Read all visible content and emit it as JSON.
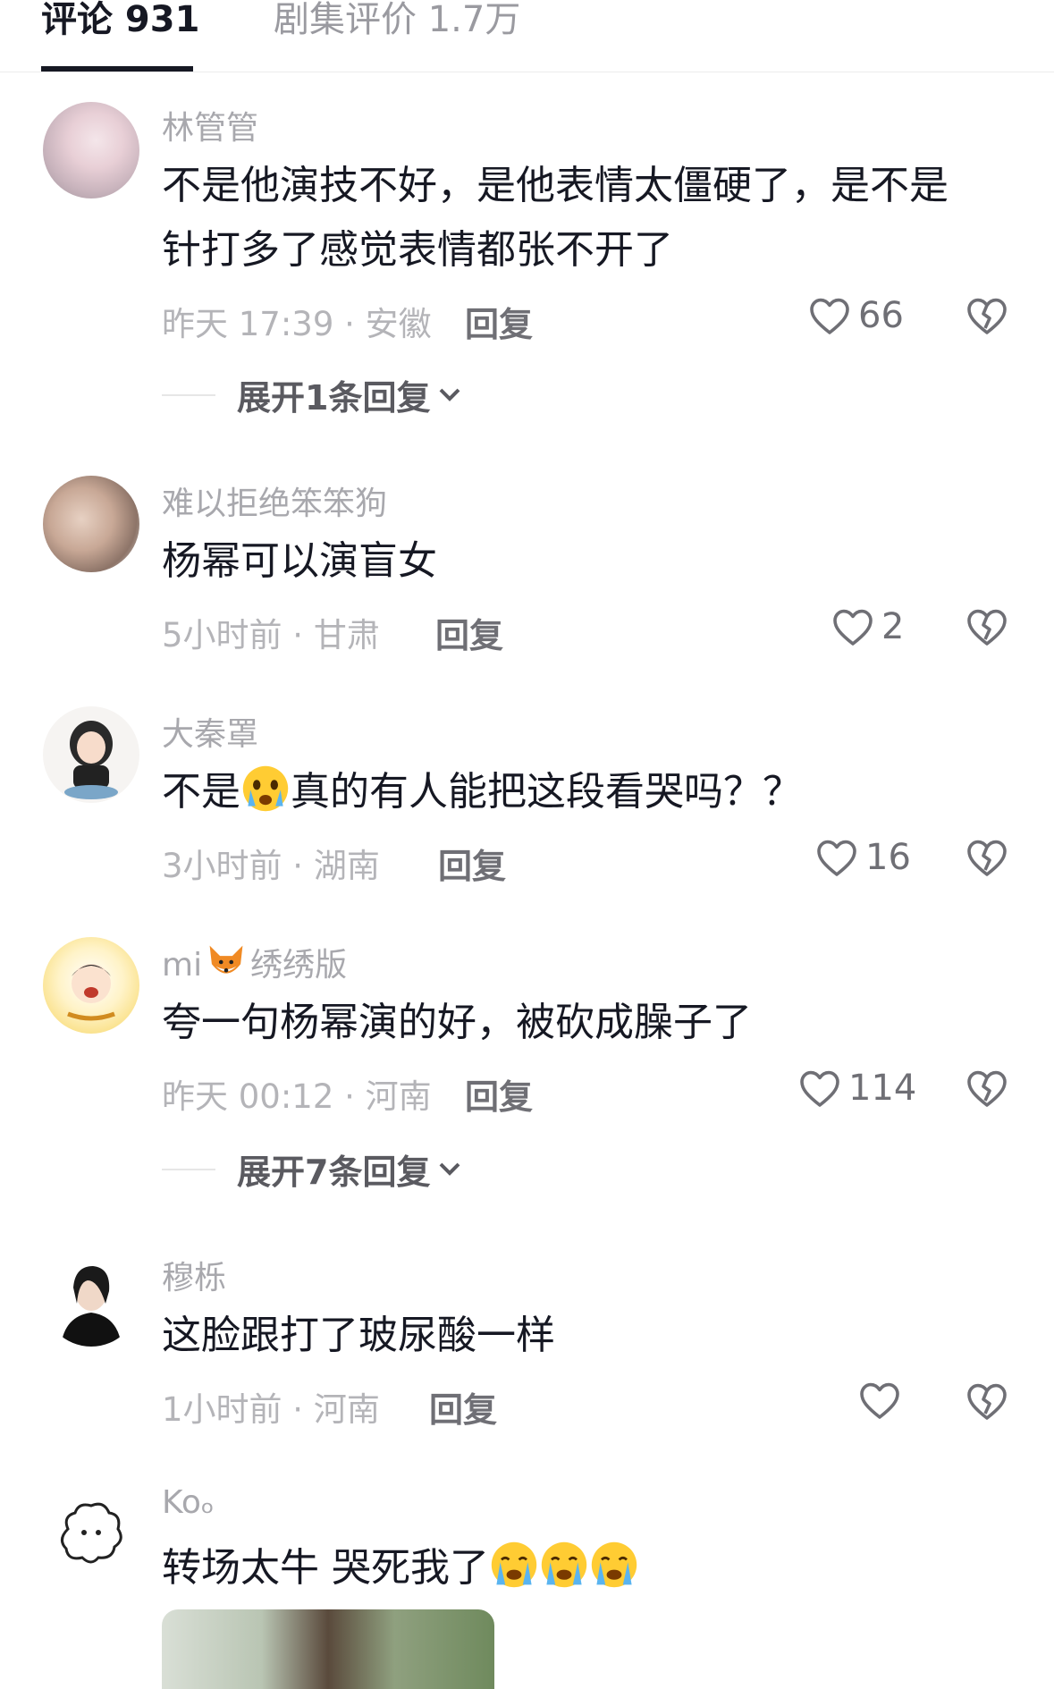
{
  "tabs": {
    "comments": "评论 931",
    "reviews": "剧集评价 1.7万"
  },
  "comments": [
    {
      "user": "林管管",
      "line1": "不是他演技不好，是他表情太僵硬了，是不是",
      "line2": "针打多了感觉表情都张不开了",
      "meta": "昨天 17:39 · 安徽",
      "reply": "回复",
      "likes": "66",
      "expand": "展开1条回复"
    },
    {
      "user": "难以拒绝笨笨狗",
      "text": "杨幂可以演盲女",
      "meta": "5小时前 · 甘肃",
      "reply": "回复",
      "likes": "2"
    },
    {
      "user": "大秦罩",
      "text_a": "不是",
      "text_b": "真的有人能把这段看哭吗？？",
      "meta": "3小时前 · 湖南",
      "reply": "回复",
      "likes": "16"
    },
    {
      "user_a": "mi",
      "user_b": "绣绣版",
      "text": "夸一句杨幂演的好，被砍成臊子了",
      "meta": "昨天 00:12 · 河南",
      "reply": "回复",
      "likes": "114",
      "expand": "展开7条回复"
    },
    {
      "user": "穆栎",
      "text": "这脸跟打了玻尿酸一样",
      "meta": "1小时前 · 河南",
      "reply": "回复",
      "likes": ""
    },
    {
      "user": "Koₒ",
      "text": "转场太牛 哭死我了",
      "meta": "",
      "reply": ""
    }
  ]
}
